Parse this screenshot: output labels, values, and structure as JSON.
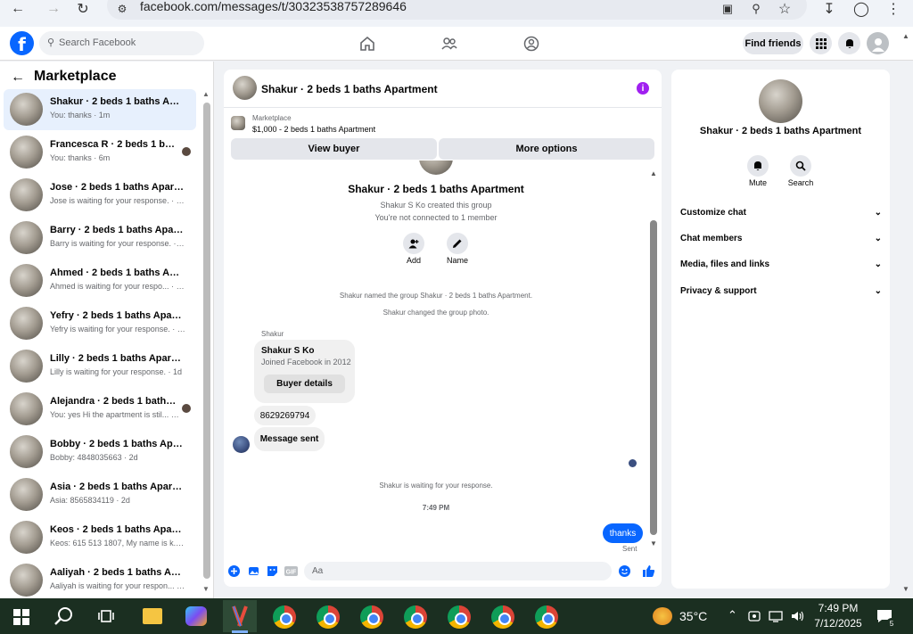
{
  "browser": {
    "url": "facebook.com/messages/t/30323538757289646"
  },
  "header": {
    "search_placeholder": "Search Facebook",
    "find_friends": "Find friends"
  },
  "sidebar": {
    "title": "Marketplace",
    "conversations": [
      {
        "name": "Shakur · 2 beds 1 baths Apartm...",
        "preview": "You: thanks · 1m"
      },
      {
        "name": "Francesca R · 2 beds 1 baths ...",
        "preview": "You: thanks · 6m"
      },
      {
        "name": "Jose · 2 beds 1 baths Apartment",
        "preview": "Jose is waiting for your response. · 14h"
      },
      {
        "name": "Barry · 2 beds 1 baths Apartment",
        "preview": "Barry is waiting for your response. · 14h"
      },
      {
        "name": "Ahmed · 2 beds 1 baths Apartm...",
        "preview": "Ahmed is waiting for your respo... · 14h"
      },
      {
        "name": "Yefry · 2 beds 1 baths Apartment",
        "preview": "Yefry is waiting for your response. · 1d"
      },
      {
        "name": "Lilly · 2 beds 1 baths Apartment",
        "preview": "Lilly is waiting for your response. · 1d"
      },
      {
        "name": "Alejandra · 2 beds 1 baths Ap...",
        "preview": "You: yes Hi the apartment is stil... · 2d"
      },
      {
        "name": "Bobby · 2 beds 1 baths Apartm...",
        "preview": "Bobby: 4848035663 · 2d"
      },
      {
        "name": "Asia · 2 beds 1 baths Apartment",
        "preview": "Asia: 8565834119 · 2d"
      },
      {
        "name": "Keos · 2 beds 1 baths Apartment",
        "preview": "Keos: 615 513 1807, My name is k... · 3d"
      },
      {
        "name": "Aaliyah · 2 beds 1 baths Apart...",
        "preview": "Aaliyah is waiting for your respon... · 3d"
      }
    ]
  },
  "chat": {
    "title": "Shakur · 2 beds 1 baths Apartment",
    "marketplace_label": "Marketplace",
    "listing": "$1,000 - 2 beds 1 baths Apartment",
    "view_buyer": "View buyer",
    "more_options": "More options",
    "group_name": "Shakur · 2 beds 1 baths Apartment",
    "created_by": "Shakur S Ko created this group",
    "not_connected": "You're not connected to 1 member",
    "add_label": "Add",
    "name_label": "Name",
    "event_1": "Shakur named the group Shakur · 2 beds 1 baths Apartment.",
    "event_2": "Shakur changed the group photo.",
    "sender": "Shakur",
    "card_name": "Shakur S Ko",
    "card_joined": "Joined Facebook in 2012",
    "buyer_details": "Buyer details",
    "msg_phone": "8629269794",
    "msg_sent": "Message sent",
    "waiting": "Shakur is waiting for your response.",
    "time": "7:49 PM",
    "my_msg": "thanks",
    "status": "Sent",
    "composer_placeholder": "Aa"
  },
  "info": {
    "title": "Shakur · 2 beds 1 baths Apartment",
    "mute": "Mute",
    "search": "Search",
    "rows": [
      "Customize chat",
      "Chat members",
      "Media, files and links",
      "Privacy & support"
    ]
  },
  "taskbar": {
    "temperature": "35°C",
    "time": "7:49 PM",
    "date": "7/12/2025",
    "notif_count": "5"
  },
  "colors": {
    "fb_blue": "#0866ff",
    "info_purple": "#a020f0",
    "taskbar": "#1b2f21"
  }
}
